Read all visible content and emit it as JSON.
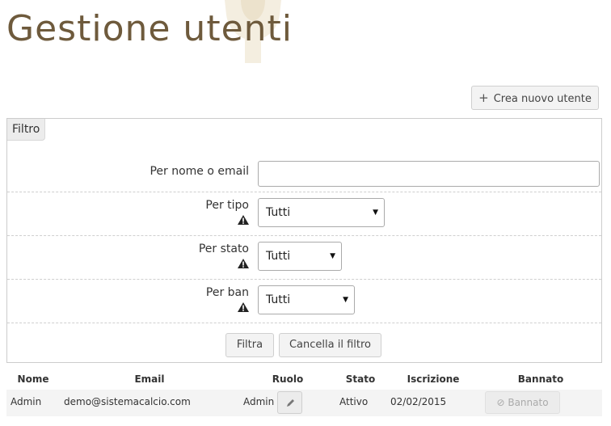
{
  "page": {
    "title": "Gestione utenti"
  },
  "toolbar": {
    "new_user_icon": "plus-icon",
    "new_user_label": "Crea nuovo utente"
  },
  "filter": {
    "legend": "Filtro",
    "name_email": {
      "label": "Per nome o email",
      "value": ""
    },
    "type": {
      "label": "Per tipo",
      "selected": "Tutti"
    },
    "state": {
      "label": "Per stato",
      "selected": "Tutti"
    },
    "ban": {
      "label": "Per ban",
      "selected": "Tutti"
    },
    "filter_button": "Filtra",
    "clear_button": "Cancella il filtro"
  },
  "table": {
    "headers": [
      "Nome",
      "Email",
      "Ruolo",
      "Stato",
      "Iscrizione",
      "Bannato"
    ],
    "rows": [
      {
        "name": "Admin",
        "email": "demo@sistemacalcio.com",
        "role": "Admin",
        "state": "Attivo",
        "signup": "02/02/2015",
        "banned_label": "Bannato"
      }
    ]
  },
  "colors": {
    "title": "#6e5a3c",
    "watermark": "#f1ead9"
  }
}
